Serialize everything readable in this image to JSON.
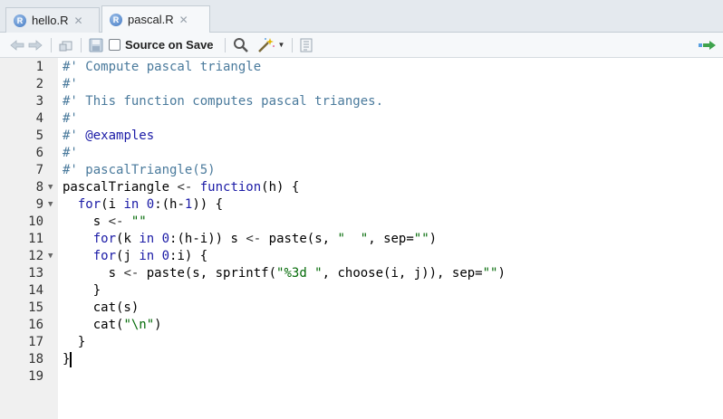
{
  "tabs": [
    {
      "label": "hello.R",
      "icon": "r-file-icon",
      "active": false
    },
    {
      "label": "pascal.R",
      "icon": "r-file-icon",
      "active": true
    }
  ],
  "toolbar": {
    "source_on_save_label": "Source on Save",
    "source_on_save_checked": false,
    "icons": [
      "back-arrow-icon",
      "forward-arrow-icon",
      "show-in-window-icon",
      "save-icon",
      "search-icon",
      "magic-wand-icon",
      "document-outline-icon",
      "run-icon"
    ]
  },
  "editor": {
    "language": "R",
    "lines": [
      {
        "n": "1",
        "fold": false,
        "tokens": [
          {
            "t": "#' Compute pascal triangle",
            "c": "comment"
          }
        ]
      },
      {
        "n": "2",
        "fold": false,
        "tokens": [
          {
            "t": "#'",
            "c": "comment"
          }
        ]
      },
      {
        "n": "3",
        "fold": false,
        "tokens": [
          {
            "t": "#' This function computes pascal trianges.",
            "c": "comment"
          }
        ]
      },
      {
        "n": "4",
        "fold": false,
        "tokens": [
          {
            "t": "#'",
            "c": "comment"
          }
        ]
      },
      {
        "n": "5",
        "fold": false,
        "tokens": [
          {
            "t": "#' ",
            "c": "comment"
          },
          {
            "t": "@examples",
            "c": "roxygen"
          }
        ]
      },
      {
        "n": "6",
        "fold": false,
        "tokens": [
          {
            "t": "#'",
            "c": "comment"
          }
        ]
      },
      {
        "n": "7",
        "fold": false,
        "tokens": [
          {
            "t": "#' pascalTriangle(5)",
            "c": "comment"
          }
        ]
      },
      {
        "n": "8",
        "fold": true,
        "tokens": [
          {
            "t": "pascalTriangle ",
            "c": "plain"
          },
          {
            "t": "<- ",
            "c": "punct"
          },
          {
            "t": "function",
            "c": "keyword"
          },
          {
            "t": "(h) {",
            "c": "plain"
          }
        ]
      },
      {
        "n": "9",
        "fold": true,
        "tokens": [
          {
            "t": "  ",
            "c": "plain"
          },
          {
            "t": "for",
            "c": "keyword"
          },
          {
            "t": "(i ",
            "c": "plain"
          },
          {
            "t": "in",
            "c": "keyword"
          },
          {
            "t": " ",
            "c": "plain"
          },
          {
            "t": "0",
            "c": "number"
          },
          {
            "t": ":(h-",
            "c": "plain"
          },
          {
            "t": "1",
            "c": "number"
          },
          {
            "t": ")) {",
            "c": "plain"
          }
        ]
      },
      {
        "n": "10",
        "fold": false,
        "tokens": [
          {
            "t": "    s ",
            "c": "plain"
          },
          {
            "t": "<- ",
            "c": "punct"
          },
          {
            "t": "\"\"",
            "c": "string"
          }
        ]
      },
      {
        "n": "11",
        "fold": false,
        "tokens": [
          {
            "t": "    ",
            "c": "plain"
          },
          {
            "t": "for",
            "c": "keyword"
          },
          {
            "t": "(k ",
            "c": "plain"
          },
          {
            "t": "in",
            "c": "keyword"
          },
          {
            "t": " ",
            "c": "plain"
          },
          {
            "t": "0",
            "c": "number"
          },
          {
            "t": ":(h-i)) s ",
            "c": "plain"
          },
          {
            "t": "<- ",
            "c": "punct"
          },
          {
            "t": "paste(s, ",
            "c": "plain"
          },
          {
            "t": "\"  \"",
            "c": "string"
          },
          {
            "t": ", sep=",
            "c": "plain"
          },
          {
            "t": "\"\"",
            "c": "string"
          },
          {
            "t": ")",
            "c": "plain"
          }
        ]
      },
      {
        "n": "12",
        "fold": true,
        "tokens": [
          {
            "t": "    ",
            "c": "plain"
          },
          {
            "t": "for",
            "c": "keyword"
          },
          {
            "t": "(j ",
            "c": "plain"
          },
          {
            "t": "in",
            "c": "keyword"
          },
          {
            "t": " ",
            "c": "plain"
          },
          {
            "t": "0",
            "c": "number"
          },
          {
            "t": ":i) {",
            "c": "plain"
          }
        ]
      },
      {
        "n": "13",
        "fold": false,
        "tokens": [
          {
            "t": "      s ",
            "c": "plain"
          },
          {
            "t": "<- ",
            "c": "punct"
          },
          {
            "t": "paste(s, sprintf(",
            "c": "plain"
          },
          {
            "t": "\"%3d \"",
            "c": "string"
          },
          {
            "t": ", choose(i, j)), sep=",
            "c": "plain"
          },
          {
            "t": "\"\"",
            "c": "string"
          },
          {
            "t": ")",
            "c": "plain"
          }
        ]
      },
      {
        "n": "14",
        "fold": false,
        "tokens": [
          {
            "t": "    }",
            "c": "plain"
          }
        ]
      },
      {
        "n": "15",
        "fold": false,
        "tokens": [
          {
            "t": "    cat(s)",
            "c": "plain"
          }
        ]
      },
      {
        "n": "16",
        "fold": false,
        "tokens": [
          {
            "t": "    cat(",
            "c": "plain"
          },
          {
            "t": "\"\\n\"",
            "c": "string"
          },
          {
            "t": ")",
            "c": "plain"
          }
        ]
      },
      {
        "n": "17",
        "fold": false,
        "tokens": [
          {
            "t": "  }",
            "c": "plain"
          }
        ]
      },
      {
        "n": "18",
        "fold": false,
        "tokens": [
          {
            "t": "}",
            "c": "plain"
          }
        ]
      },
      {
        "n": "19",
        "fold": false,
        "tokens": []
      }
    ],
    "cursor_line": 18
  },
  "colors": {
    "comment": "#4a7a9c",
    "keyword": "#1a1aa6",
    "string": "#036a07",
    "gutter_bg": "#f0f0f0",
    "toolbar_bg": "#f6f8fa"
  }
}
